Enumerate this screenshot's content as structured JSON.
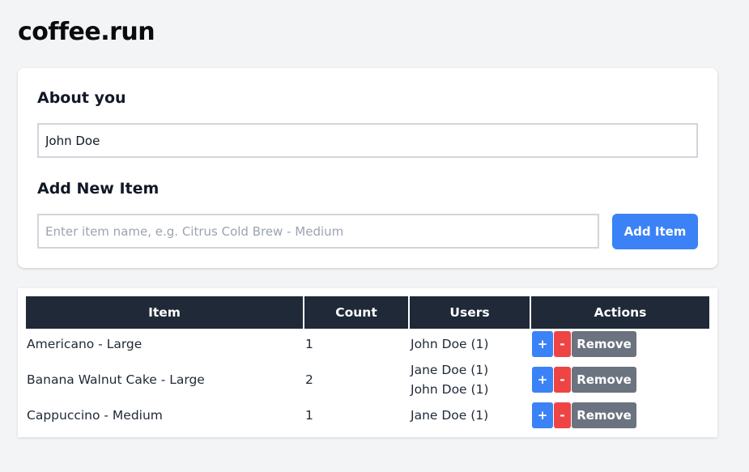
{
  "app": {
    "title": "coffee.run"
  },
  "about": {
    "heading": "About you",
    "name_value": "John Doe"
  },
  "add_item": {
    "heading": "Add New Item",
    "placeholder": "Enter item name, e.g. Citrus Cold Brew - Medium",
    "button_label": "Add Item"
  },
  "table": {
    "headers": [
      "Item",
      "Count",
      "Users",
      "Actions"
    ],
    "rows": [
      {
        "item": "Americano - Large",
        "count": "1",
        "users": [
          "John Doe (1)"
        ]
      },
      {
        "item": "Banana Walnut Cake - Large",
        "count": "2",
        "users": [
          "Jane Doe (1)",
          "John Doe (1)"
        ]
      },
      {
        "item": "Cappuccino - Medium",
        "count": "1",
        "users": [
          "Jane Doe (1)"
        ]
      }
    ],
    "actions": {
      "plus": "+",
      "minus": "-",
      "remove": "Remove"
    }
  },
  "colors": {
    "primary": "#3b82f6",
    "danger": "#ef4444",
    "secondary": "#6b7280",
    "header_bg": "#1f2937",
    "page_bg": "#f3f4f6"
  }
}
